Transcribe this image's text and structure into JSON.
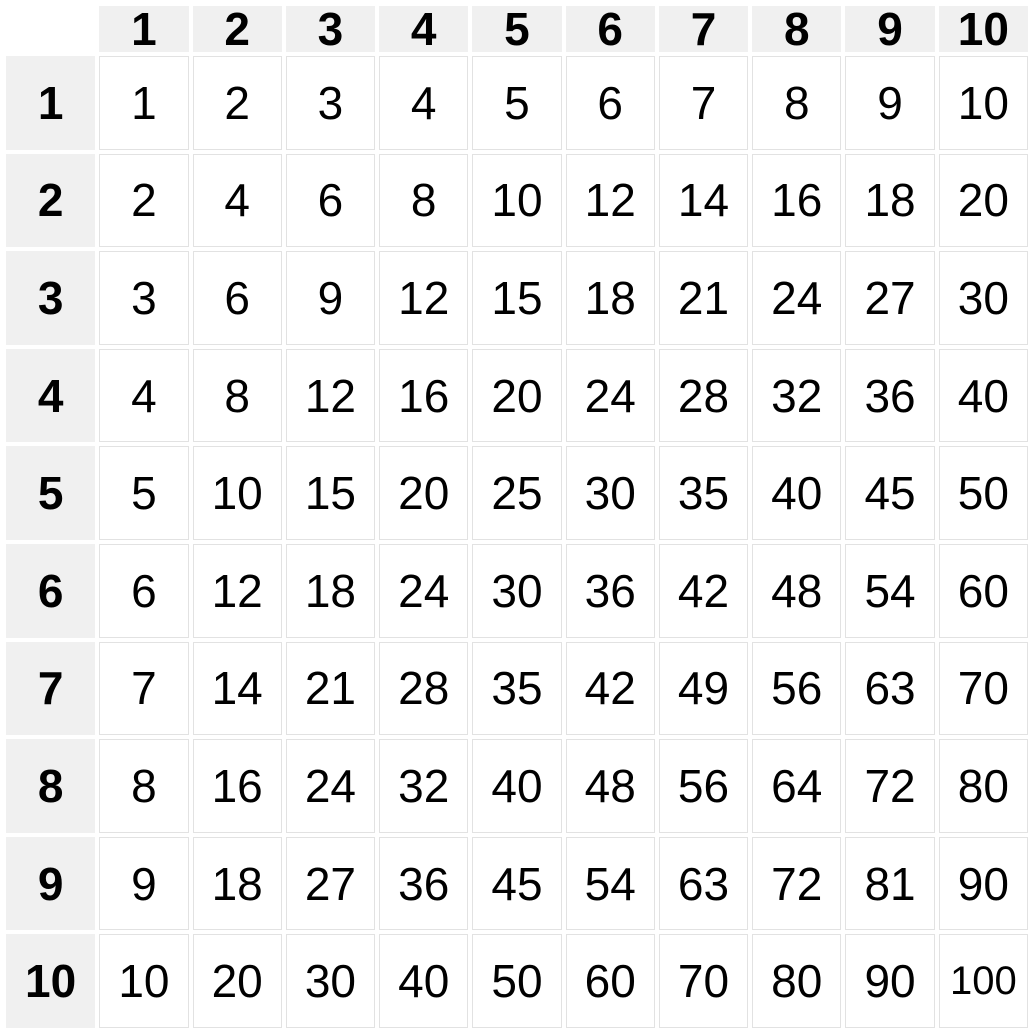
{
  "chart_data": {
    "type": "table",
    "title": "",
    "column_headers": [
      "1",
      "2",
      "3",
      "4",
      "5",
      "6",
      "7",
      "8",
      "9",
      "10"
    ],
    "row_headers": [
      "1",
      "2",
      "3",
      "4",
      "5",
      "6",
      "7",
      "8",
      "9",
      "10"
    ],
    "rows": [
      [
        1,
        2,
        3,
        4,
        5,
        6,
        7,
        8,
        9,
        10
      ],
      [
        2,
        4,
        6,
        8,
        10,
        12,
        14,
        16,
        18,
        20
      ],
      [
        3,
        6,
        9,
        12,
        15,
        18,
        21,
        24,
        27,
        30
      ],
      [
        4,
        8,
        12,
        16,
        20,
        24,
        28,
        32,
        36,
        40
      ],
      [
        5,
        10,
        15,
        20,
        25,
        30,
        35,
        40,
        45,
        50
      ],
      [
        6,
        12,
        18,
        24,
        30,
        36,
        42,
        48,
        54,
        60
      ],
      [
        7,
        14,
        21,
        28,
        35,
        42,
        49,
        56,
        63,
        70
      ],
      [
        8,
        16,
        24,
        32,
        40,
        48,
        56,
        64,
        72,
        80
      ],
      [
        9,
        18,
        27,
        36,
        45,
        54,
        63,
        72,
        81,
        90
      ],
      [
        10,
        20,
        30,
        40,
        50,
        60,
        70,
        80,
        90,
        100
      ]
    ]
  }
}
